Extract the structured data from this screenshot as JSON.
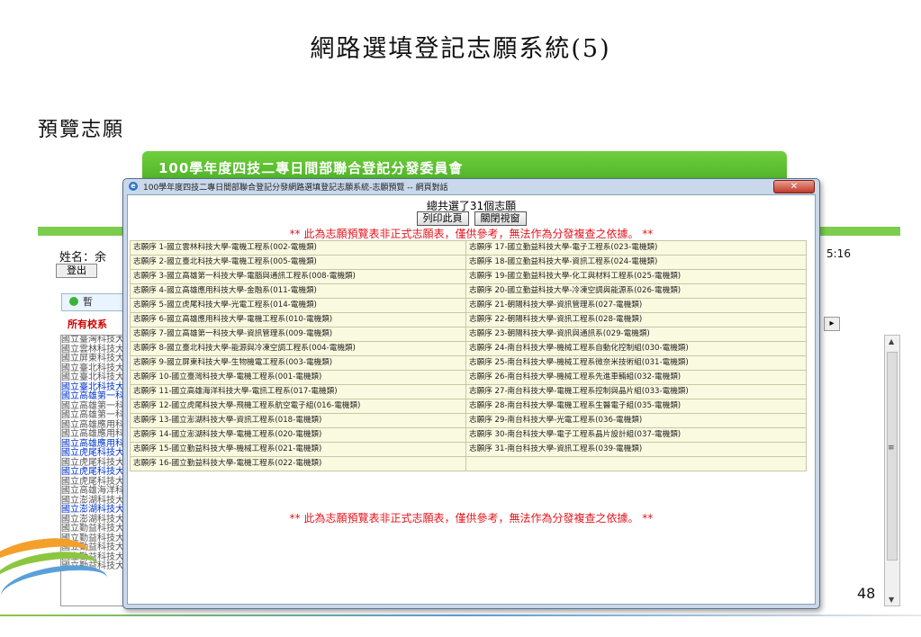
{
  "slide": {
    "title": "網路選填登記志願系統(5)",
    "subtitle": "預覽志願",
    "page_number": "48"
  },
  "background_page": {
    "banner_title": "100學年度四技二專日間部聯合登記分發委員會",
    "name_label": "姓名：余",
    "time_fragment": "5:16",
    "logout_label": "登出",
    "temp_button_label": "暫",
    "all_schools_label": "所有校系",
    "school_list": [
      {
        "text": "國立臺灣科技大",
        "highlight": false
      },
      {
        "text": "國立雲林科技大",
        "highlight": false
      },
      {
        "text": "國立屏東科技大",
        "highlight": false
      },
      {
        "text": "國立臺北科技大",
        "highlight": false
      },
      {
        "text": "國立臺北科技大",
        "highlight": false
      },
      {
        "text": "國立臺北科技大",
        "highlight": true
      },
      {
        "text": "國立高雄第一科",
        "highlight": true
      },
      {
        "text": "國立高雄第一科",
        "highlight": false
      },
      {
        "text": "國立高雄第一科",
        "highlight": false
      },
      {
        "text": "國立高雄應用科",
        "highlight": false
      },
      {
        "text": "國立高雄應用科",
        "highlight": false
      },
      {
        "text": "國立高雄應用科",
        "highlight": true
      },
      {
        "text": "國立虎尾科技大",
        "highlight": true
      },
      {
        "text": "國立虎尾科技大",
        "highlight": false
      },
      {
        "text": "國立虎尾科技大",
        "highlight": true
      },
      {
        "text": "國立虎尾科技大",
        "highlight": false
      },
      {
        "text": "國立高雄海洋科",
        "highlight": false
      },
      {
        "text": "國立澎湖科技大",
        "highlight": false
      },
      {
        "text": "國立澎湖科技大",
        "highlight": true
      },
      {
        "text": "國立澎湖科技大",
        "highlight": false
      },
      {
        "text": "國立勤益科技大",
        "highlight": false
      },
      {
        "text": "國立勤益科技大",
        "highlight": false
      },
      {
        "text": "國立勤益科技大",
        "highlight": false
      },
      {
        "text": "國立勤益科技大",
        "highlight": false
      },
      {
        "text": "國立勤益科技大",
        "highlight": false
      }
    ]
  },
  "dialog": {
    "title": "100學年度四技二專日間部聯合登記分發網路選填登記志願系統-志願預覽 -- 網頁對話",
    "close_label": "✕",
    "total_text": "總共選了31個志願",
    "print_button": "列印此頁",
    "close_button": "關閉視窗",
    "warning_text": "** 此為志願預覽表非正式志願表，僅供參考，無法作為分發複查之依據。 **",
    "left_column": [
      "志願序 1-國立雲林科技大學-電機工程系(002-電機類)",
      "志願序 2-國立臺北科技大學-電機工程系(005-電機類)",
      "志願序 3-國立高雄第一科技大學-電腦與通訊工程系(008-電機類)",
      "志願序 4-國立高雄應用科技大學-金融系(011-電機類)",
      "志願序 5-國立虎尾科技大學-光電工程系(014-電機類)",
      "志願序 6-國立高雄應用科技大學-電機工程系(010-電機類)",
      "志願序 7-國立高雄第一科技大學-資訊管理系(009-電機類)",
      "志願序 8-國立臺北科技大學-能源與冷凍空調工程系(004-電機類)",
      "志願序 9-國立屏東科技大學-生物機電工程系(003-電機類)",
      "志願序 10-國立臺灣科技大學-電機工程系(001-電機類)",
      "志願序 11-國立高雄海洋科技大學-電訊工程系(017-電機類)",
      "志願序 12-國立虎尾科技大學-飛機工程系航空電子組(016-電機類)",
      "志願序 13-國立澎湖科技大學-資訊工程系(018-電機類)",
      "志願序 14-國立澎湖科技大學-電機工程系(020-電機類)",
      "志願序 15-國立勤益科技大學-機械工程系(021-電機類)",
      "志願序 16-國立勤益科技大學-電機工程系(022-電機類)"
    ],
    "right_column": [
      "志願序 17-國立勤益科技大學-電子工程系(023-電機類)",
      "志願序 18-國立勤益科技大學-資訊工程系(024-電機類)",
      "志願序 19-國立勤益科技大學-化工與材料工程系(025-電機類)",
      "志願序 20-國立勤益科技大學-冷凍空調與能源系(026-電機類)",
      "志願序 21-朝陽科技大學-資訊管理系(027-電機類)",
      "志願序 22-朝陽科技大學-資訊工程系(028-電機類)",
      "志願序 23-朝陽科技大學-資訊與通訊系(029-電機類)",
      "志願序 24-南台科技大學-機械工程系自動化控制組(030-電機類)",
      "志願序 25-南台科技大學-機械工程系微奈米技術組(031-電機類)",
      "志願序 26-南台科技大學-機械工程系先進車輛組(032-電機類)",
      "志願序 27-南台科技大學-電機工程系控制與晶片組(033-電機類)",
      "志願序 28-南台科技大學-電機工程系生醫電子組(035-電機類)",
      "志願序 29-南台科技大學-光電工程系(036-電機類)",
      "志願序 30-南台科技大學-電子工程系晶片設計組(037-電機類)",
      "志願序 31-南台科技大學-資訊工程系(039-電機類)",
      ""
    ]
  }
}
